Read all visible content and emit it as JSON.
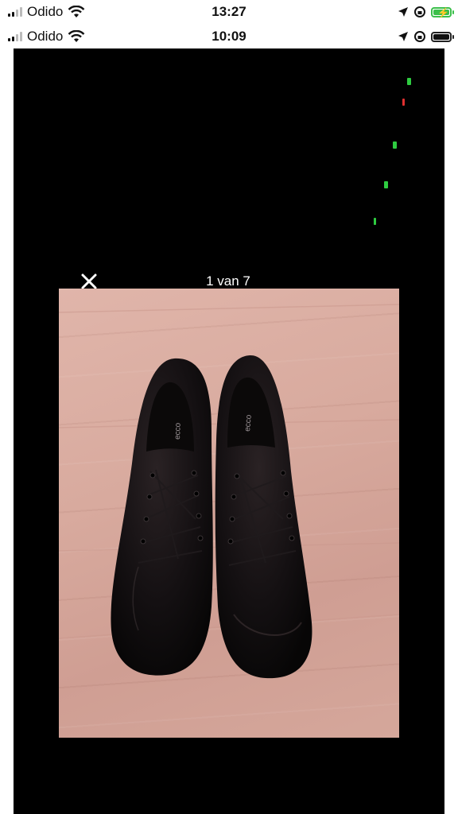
{
  "status_outer": {
    "carrier": "Odido",
    "time": "13:27",
    "battery": "charging"
  },
  "status_inner": {
    "carrier": "Odido",
    "time": "10:09",
    "battery": "full"
  },
  "viewer": {
    "close_icon": "close-icon",
    "counter": "1 van 7",
    "photo": "black-leather-shoes-photo",
    "indicator_colors": [
      "#2ecc40",
      "#e03030",
      "#2ecc40",
      "#2ecc40",
      "#2ecc40"
    ]
  },
  "colors": {
    "background": "#000000",
    "charging": "#3bbf4a",
    "text": "#ffffff"
  }
}
